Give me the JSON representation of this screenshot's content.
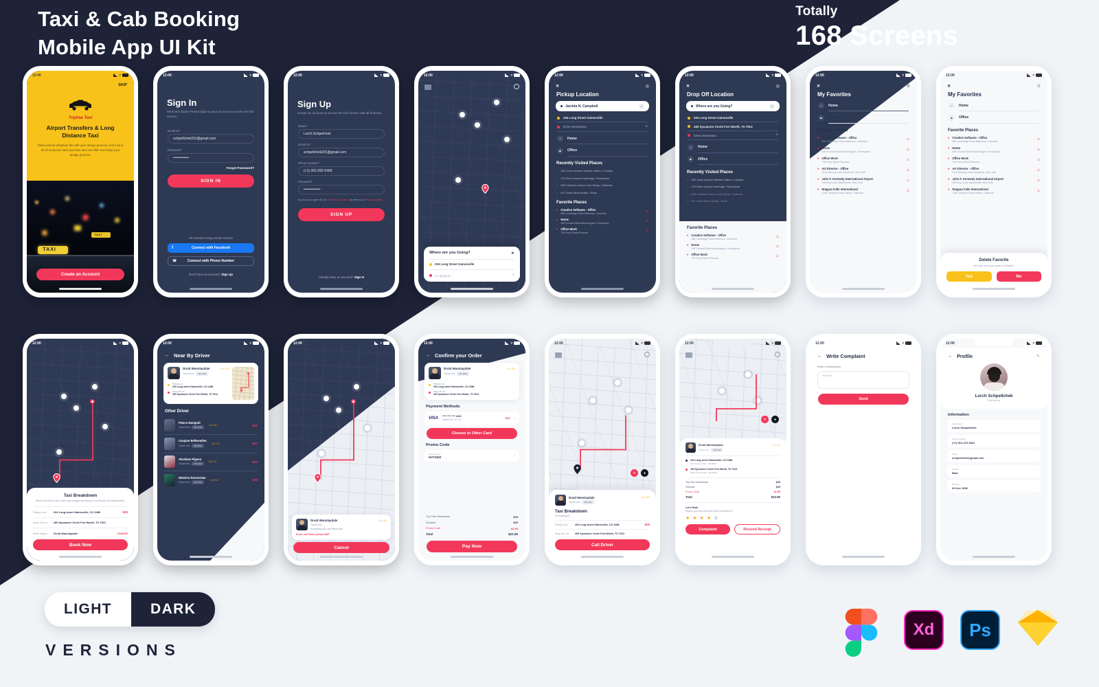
{
  "hero": {
    "title_line1": "Taxi & Cab Booking",
    "title_line2": "Mobile App UI Kit",
    "totally_label": "Totally",
    "screens_count": "168 Screens"
  },
  "footer": {
    "light_label": "LIGHT",
    "dark_label": "DARK",
    "versions_label": "VERSIONS",
    "tools": [
      "figma-icon",
      "adobe-xd-icon",
      "photoshop-icon",
      "sketch-icon"
    ],
    "xd_label": "Xd",
    "ps_label": "Ps"
  },
  "status_bar": {
    "time": "12:00",
    "location_glyph": "✈"
  },
  "colors": {
    "dark_navy": "#1e2338",
    "screen_navy": "#2e3954",
    "accent_red": "#f2385a",
    "accent_yellow": "#f9c21a",
    "light_bg": "#f1f4f7",
    "facebook_blue": "#1877f2"
  },
  "screens": [
    {
      "id": "onboarding",
      "name": "Onboarding / Splash",
      "skip_label": "SKIP",
      "brand": "Triplise Taxi",
      "heading": "Airport Transfers & Long Distance Taxi",
      "body": "Relax and do whatever fits with your design process. Don't set a lot of restrictive hard and fast rules use filler text helps your design process.",
      "cta": "Create an Account"
    },
    {
      "id": "sign-in",
      "name": "Sign In",
      "title": "Sign In",
      "subtitle": "Welcome Back! Please login to your account to access the full version.",
      "email_label": "Email ID*",
      "email_value": "schpellchek201@gmail.com",
      "password_label": "Password*",
      "password_value": "•••••••••••••",
      "forgot": "Forgot Password?",
      "submit": "SIGN IN",
      "social_divider": "Or Connect using social Account",
      "facebook_btn": "Connect with Facebook",
      "phone_btn": "Connect with Phone Number",
      "footer_text": "Don't have an account?",
      "footer_link": "Sign Up"
    },
    {
      "id": "sign-up",
      "name": "Sign Up",
      "title": "Sign Up",
      "subtitle": "Create  an account to access the full version with all features.",
      "name_label": "Name*",
      "name_value": "Lurch Schpelchek",
      "email_label": "Email ID*",
      "email_value": "schpellchek201@gmail.com",
      "phone_label": "Phone Number*",
      "phone_value": "(+1) 352-282-5409",
      "password_label": "Password*",
      "password_value": "••••••••••••••",
      "terms_prefix": "By click you agree to our",
      "terms_link": "Terms & Condition",
      "terms_mid": "as well as our",
      "privacy_link": "Privacy policy",
      "submit": "SIGN UP",
      "footer_text": "Already have an account?",
      "footer_link": "Sign In"
    },
    {
      "id": "home-map",
      "name": "Home Map Search",
      "search_placeholder": "Where are you Going?",
      "current_location": "204 Long Street Gainesville",
      "destination_placeholder": "I'm going to ..."
    },
    {
      "id": "pickup-location",
      "name": "Pickup Location",
      "title": "Pickup Location",
      "search_value": "Jacinta N. Campbell",
      "stops": [
        {
          "label": "204 Long Street Gainesville",
          "color": "yellow"
        },
        {
          "label": "Enter Destination",
          "color": "red"
        }
      ],
      "quick": [
        "Home",
        "Office"
      ],
      "recent_title": "Recently Visited Places",
      "recent": [
        "330 Jones Avenue Winston Salem, Coombs",
        "219 Sherr Avenue Ambridge, Pennsylvan",
        "845 Coleman Avenue San Diego, California",
        "617 Short Street Austin, Texas"
      ],
      "favorites_title": "Favorite Places",
      "favorites": [
        {
          "name": "Creative Software - Office",
          "addr": "956 Cambridge Place Baltimore, Colombia"
        },
        {
          "name": "Home",
          "addr": "305 Orchard Street Bloomington, Pennsylvan"
        },
        {
          "name": "Office Work",
          "addr": "720 Ferry Street Florence"
        }
      ]
    },
    {
      "id": "dropoff-location",
      "name": "Drop Off Location",
      "title": "Drop Off Location",
      "search_value": "Where are you Going?",
      "stops": [
        {
          "label": "204 Long Street Gainesville",
          "color": "yellow"
        },
        {
          "label": "400 Sycamore Circle Fort Worth, TX 7913",
          "color": "yellow"
        },
        {
          "label": "Enter Destination",
          "color": "red"
        }
      ],
      "quick": [
        "Home",
        "Office"
      ],
      "recent_title": "Recently Visited Places",
      "recent": [
        "330 Jones Avenue Winston Salem, Coombs",
        "219 Sherr Avenue Ambridge, Pennsylvan",
        "845 Coleman Avenue San Diego, California",
        "617 Short Street Austin, Texas"
      ],
      "favorites_title": "Favorite Places",
      "favorites": [
        {
          "name": "Creative Software - Office",
          "addr": "956 Cambridge Place Baltimore, Colombia"
        },
        {
          "name": "Home",
          "addr": "305 Orchard Street Bloomington, Pennsylvan"
        },
        {
          "name": "Office Work",
          "addr": "720 Ferry Street Florence"
        }
      ]
    },
    {
      "id": "my-favorites",
      "name": "My Favorites",
      "title": "My Favorites",
      "quick": [
        "Home",
        "Office"
      ],
      "favorites_title": "Favorite Places",
      "favorites": [
        {
          "name": "Creative Software - Office",
          "addr": "956 Cambridge Place Baltimore, Colombia"
        },
        {
          "name": "Home",
          "addr": "305 Orchard Street Bloomington, Pennsylvan"
        },
        {
          "name": "Office Work",
          "addr": "720 Ferry Street Florence"
        },
        {
          "name": "Art Director - Office",
          "addr": "2913 Memory Lane Sycamore, New York"
        },
        {
          "name": "John F. Kennedy International Airport",
          "addr": "105 Roy Court Jacksonville, New York"
        },
        {
          "name": "Niagara Falls International",
          "addr": "1246 Timberer Road Palmer, California"
        }
      ]
    },
    {
      "id": "delete-favorite",
      "name": "My Favorites - Delete Dialog",
      "title": "My Favorites",
      "quick": [
        "Home",
        "Office"
      ],
      "favorites_title": "Favorite Places",
      "favorites": [
        {
          "name": "Creative Software - Office",
          "addr": "956 Cambridge Place Baltimore, Colombia"
        },
        {
          "name": "Home",
          "addr": "305 Orchard Street Bloomington, Pennsylvan"
        },
        {
          "name": "Office Work",
          "addr": "720 Ferry Street Florence"
        },
        {
          "name": "Art Director - Office",
          "addr": "2913 Memory Lane Sycamore, New York"
        },
        {
          "name": "John F. Kennedy International Airport",
          "addr": "105 Roy Court Jacksonville, New York"
        },
        {
          "name": "Niagara Falls International",
          "addr": "1246 Timberer Road Palmer, California"
        }
      ],
      "dialog_title": "Delete Favorite",
      "dialog_body": "Are you sure you want to Delete?",
      "yes_label": "Yes",
      "no_label": "No"
    },
    {
      "id": "taxi-breakdown",
      "name": "Taxi Breakdown",
      "card_title": "Taxi Breakdown",
      "card_sub": "Below mentioned fare rates may change according to surcharge and adjustments.",
      "rows": [
        {
          "label": "Pickup Loc:",
          "value": "204 Long street Gainesville, CO 2486",
          "right": "$25"
        },
        {
          "label": "Drop off Loc:",
          "value": "400 Sycamore Circle Fort Worth, TX 7913",
          "right": ""
        },
        {
          "label": "Drive Name:",
          "value": "Druid Wannlaydale",
          "right": "CHANGE"
        }
      ],
      "cta": "Book Now"
    },
    {
      "id": "near-by-driver",
      "name": "Near By Driver",
      "title": "Near By Driver",
      "featured": {
        "driver": "Druid Wannlaydale",
        "car": "Toyota Vios",
        "plate": "AB 1234",
        "rating": "4.4 / 5.0",
        "pickup_label": "Pickup Loc:",
        "pickup": "204 Long street Gainesville, CO 2486",
        "drop_label": "Drop off Loc:",
        "drop": "400 Sycamore Circle Fort Worth, TX 7913"
      },
      "others_title": "Other Driver",
      "drivers": [
        {
          "name": "Fleece Marigold",
          "car": "Toyota Vios",
          "plate": "AB 1234",
          "rating": "4.4 / 5.0",
          "price": "$40"
        },
        {
          "name": "Caspian Bellweather",
          "car": "Toyota Vios",
          "plate": "AB 8012",
          "rating": "4.6 / 5.0",
          "price": "$37"
        },
        {
          "name": "Abraham Pigeon",
          "car": "Toyota Vios",
          "plate": "AB 1144",
          "rating": "4.6 / 5.0",
          "price": "$34"
        },
        {
          "name": "Wisteria Rosenclaw",
          "car": "Toyota Vios",
          "plate": "AB 2346",
          "rating": "4.0 / 5.0",
          "price": "$29"
        }
      ]
    },
    {
      "id": "ride-cancel",
      "name": "Ride Tracking - Cancel",
      "driver": "Druid Wannlaydale",
      "rating": "4.4 / 5.0",
      "car": "Toyota Vios",
      "note": "Requesting your ride please wait...",
      "error": "Driver not Found, please SKIP",
      "cta": "Cancel"
    },
    {
      "id": "confirm-order",
      "name": "Confirm your Order",
      "title": "Confirm your Order",
      "driver": "Druid Wannlaydale",
      "car": "Toyota Vios",
      "plate": "AB 1234",
      "rating": "4.4 / 5.0",
      "pickup_label": "Pickup Loc:",
      "pickup": "204 Long street Gainesville, CO 2486",
      "drop_label": "Drop off Loc:",
      "drop": "400 Sycamore Circle Fort Worth, TX 7913",
      "payment_title": "Payment Methods",
      "card_brand": "VISA",
      "card_number": "**** **** **** 4321",
      "card_expiry": "Expires On: 12 / 22",
      "card_amount": "$25",
      "choose_card": "Choose to Other Card",
      "promo_title": "Promo Code",
      "promo_label": "Promo Code*",
      "promo_value": "HJY2402",
      "summary": [
        {
          "label": "Trip Fare Breakdown",
          "value": "$25"
        },
        {
          "label": "Subtotal",
          "value": "$25"
        },
        {
          "label": "Promo Code",
          "value": "$2.59"
        },
        {
          "label": "Total",
          "value": "$22.59"
        }
      ],
      "cta": "Pay Now"
    },
    {
      "id": "call-driver",
      "name": "Trip In Progress - Call Driver",
      "driver": "Druid Wannlaydale",
      "car": "Toyota Vios",
      "plate": "AB 1234",
      "rating": "4.4 / 5.0",
      "card_title": "Taxi Breakdown",
      "card_sub": "03 Passengers",
      "rows": [
        {
          "label": "Pickup Loc:",
          "value": "204 Long street Gainesville, CO 2486",
          "right": "$25"
        },
        {
          "label": "Drop off Loc:",
          "value": "400 Sycamore Circle Fort Worth, TX 7913",
          "right": ""
        }
      ],
      "cta": "Call Driver"
    },
    {
      "id": "trip-receipt",
      "name": "Trip Receipt & Rating",
      "driver": "Druid Wannlaydale",
      "car": "Toyota Vios",
      "plate": "AB 1234",
      "rating": "4.4 / 5.0",
      "pickup": "204 Long street Gainesville, CO 2486",
      "pickup_time": "Sun 24 Dec 2019 - 08:45PM",
      "drop": "400 Sycamore Circle Fort Worth, TX 7913",
      "drop_time": "Wed 27 Dec 2019 - 06:35AM",
      "summary": [
        {
          "label": "Trip Fare Breakdown",
          "value": "$25"
        },
        {
          "label": "Subtotal",
          "value": "$25"
        },
        {
          "label": "Promo Code",
          "value": "$2.59"
        },
        {
          "label": "Total",
          "value": "$22.59"
        }
      ],
      "rate_title": "Let's Rate",
      "rate_sub": "What do you think about the driver performance?",
      "stars_filled": 4,
      "stars_total": 5,
      "complaint_btn": "Complaint",
      "receipt_btn": "Resend Receipt"
    },
    {
      "id": "write-complaint",
      "name": "Write Complaint",
      "title": "Write Complaint",
      "field_label": "Enter a Description",
      "field_placeholder": "Write the...",
      "cta": "Send"
    },
    {
      "id": "profile",
      "name": "Profile",
      "title": "Profile",
      "user_name": "Lurch Schpellchek",
      "user_role": "Gold Member",
      "info_title": "Information",
      "fields": [
        {
          "label": "User Name",
          "value": "Lurch Schpellchek"
        },
        {
          "label": "Phone Number",
          "value": "(+1) 510-470-3521"
        },
        {
          "label": "Email",
          "value": "schpellchek@gmail.com"
        },
        {
          "label": "Gender",
          "value": "Male"
        },
        {
          "label": "Birthday",
          "value": "20 Dec 1992"
        }
      ]
    }
  ]
}
